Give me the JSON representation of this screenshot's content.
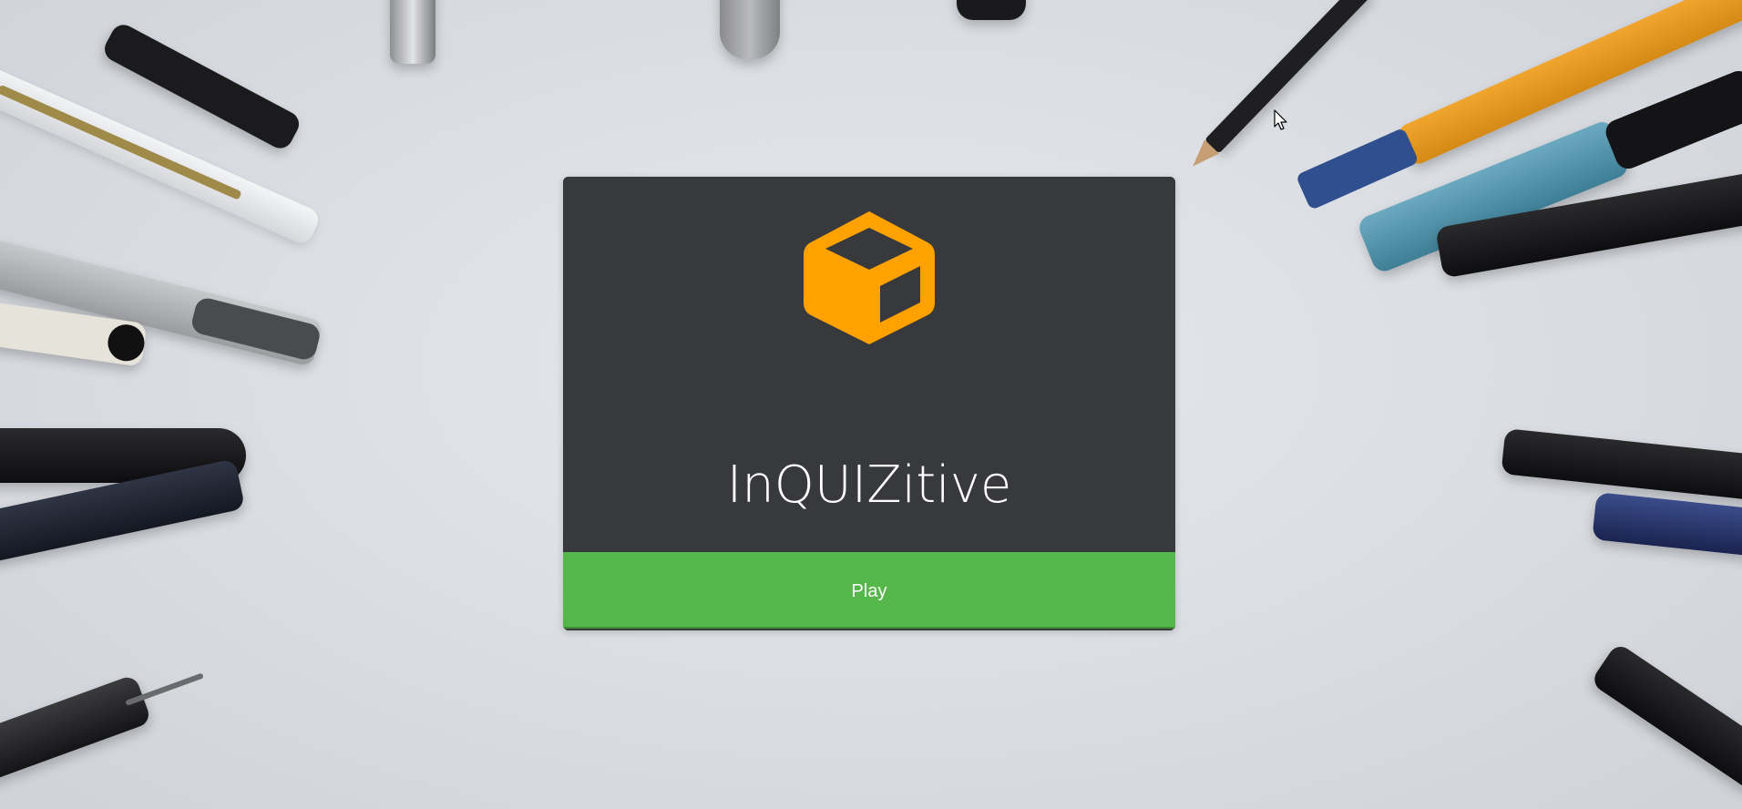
{
  "app": {
    "title": "InQUIZitive",
    "logo_icon": "cube-icon",
    "logo_color": "#FFA200",
    "card_color": "#38393C"
  },
  "actions": {
    "play_label": "Play",
    "play_color": "#55B649"
  }
}
